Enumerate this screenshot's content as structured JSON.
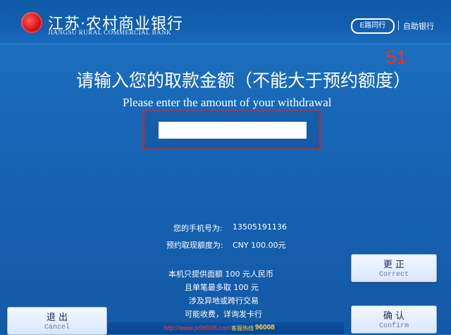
{
  "header": {
    "bank_name_cn": "江苏·农村商业银行",
    "bank_name_en": "JIANGSU RURAL COMMERCIAL BANK",
    "service_logo": "E路同行",
    "self_service_label": "自助银行",
    "logo_icon": "bank-logo-icon"
  },
  "timer": "51",
  "prompt": {
    "cn": "请输入您的取款金额（不能大于预约额度）",
    "en": "Please enter the amount of your withdrawal"
  },
  "amount_input": {
    "value": ""
  },
  "info": {
    "phone_label": "您的手机号为:",
    "phone_value": "13505191136",
    "reserved_label": "预约取现额度为:",
    "reserved_value": "CNY 100.00元",
    "notice_line1": "本机只提供面额 100 元人民币",
    "notice_line2": "且单笔最多取 100 元",
    "notice_line3": "涉及异地或跨行交易",
    "notice_line4": "可能收费，详询发卡行"
  },
  "buttons": {
    "correct_cn": "更 正",
    "correct_en": "Correct",
    "exit_cn": "退 出",
    "exit_en": "Cancel",
    "confirm_cn": "确 认",
    "confirm_en": "Confirm"
  },
  "footer": {
    "url": "http://www.js96008.com",
    "hotline_label": "客服热线",
    "hotline_number": "96008"
  },
  "colors": {
    "background": "#1867b6",
    "timer": "#ff2b2b",
    "highlight_frame": "#d4202a"
  }
}
